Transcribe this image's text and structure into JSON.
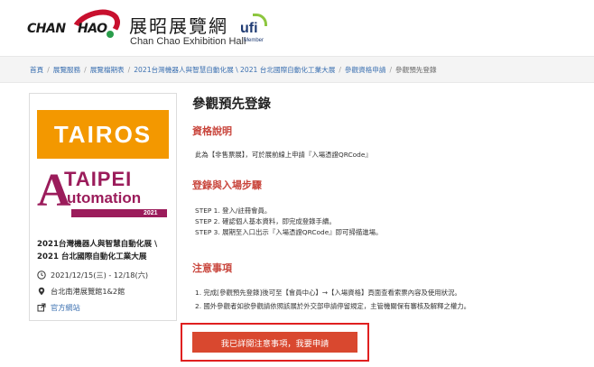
{
  "header": {
    "logo_left": "CHAN",
    "logo_right": "HAO",
    "site_name": "展昭展覽網",
    "site_name_en": "Chan Chao Exhibition Hall",
    "ufi_text": "ufi",
    "ufi_member": "Member"
  },
  "breadcrumb": [
    {
      "label": "首頁"
    },
    {
      "label": "展覽服務"
    },
    {
      "label": "展覽檔期表"
    },
    {
      "label": "2021台灣機器人與智慧自動化展 \\ 2021 台北國際自動化工業大展"
    },
    {
      "label": "參觀資格申請"
    },
    {
      "label": "參觀預先登錄"
    }
  ],
  "breadcrumb_separator": "/",
  "sidebar": {
    "tairos_logo": "TAIROS",
    "taipei_logo": "TAIPEI",
    "automation_logo_a": "A",
    "automation_logo_rest": "utomation",
    "logo_year": "2021",
    "event_title_line1": "2021台灣機器人與智慧自動化展 \\",
    "event_title_line2": "2021 台北國際自動化工業大展",
    "date": "2021/12/15(三) - 12/18(六)",
    "venue": "台北南港展覽館1&2館",
    "website_label": "官方網站"
  },
  "main": {
    "title": "參觀預先登錄",
    "section1_heading": "資格說明",
    "section1_text": "此為【非售票展】，可於展前線上申請『入場憑證QRCode』",
    "section2_heading": "登錄與入場步驟",
    "steps": [
      "STEP 1. 登入/註冊會員。",
      "STEP 2. 確認個人基本資料，即完成登錄手續。",
      "STEP 3. 展期至入口出示『入場憑證QRCode』即可掃描進場。"
    ],
    "section3_heading": "注意事項",
    "notes": [
      "1. 完成[參觀預先登錄]後可至【會員中心】→【入場資格】頁面查看索票內容及使用狀況。",
      "2. 國外參觀者如欲參觀請依照該展於外交部申請停留規定，主管機關保有審核及解釋之權力。"
    ],
    "apply_button": "我已詳閱注意事項，我要申請"
  },
  "colors": {
    "accent_red": "#c9463d",
    "button_bg": "#d9482f",
    "highlight_border": "#e02020",
    "link_blue": "#3a6fb0",
    "tairos_orange": "#f39800",
    "automation_purple": "#9b1c5b"
  },
  "icons": {
    "date": "calendar-icon",
    "venue": "location-pin-icon",
    "website": "external-link-icon"
  }
}
